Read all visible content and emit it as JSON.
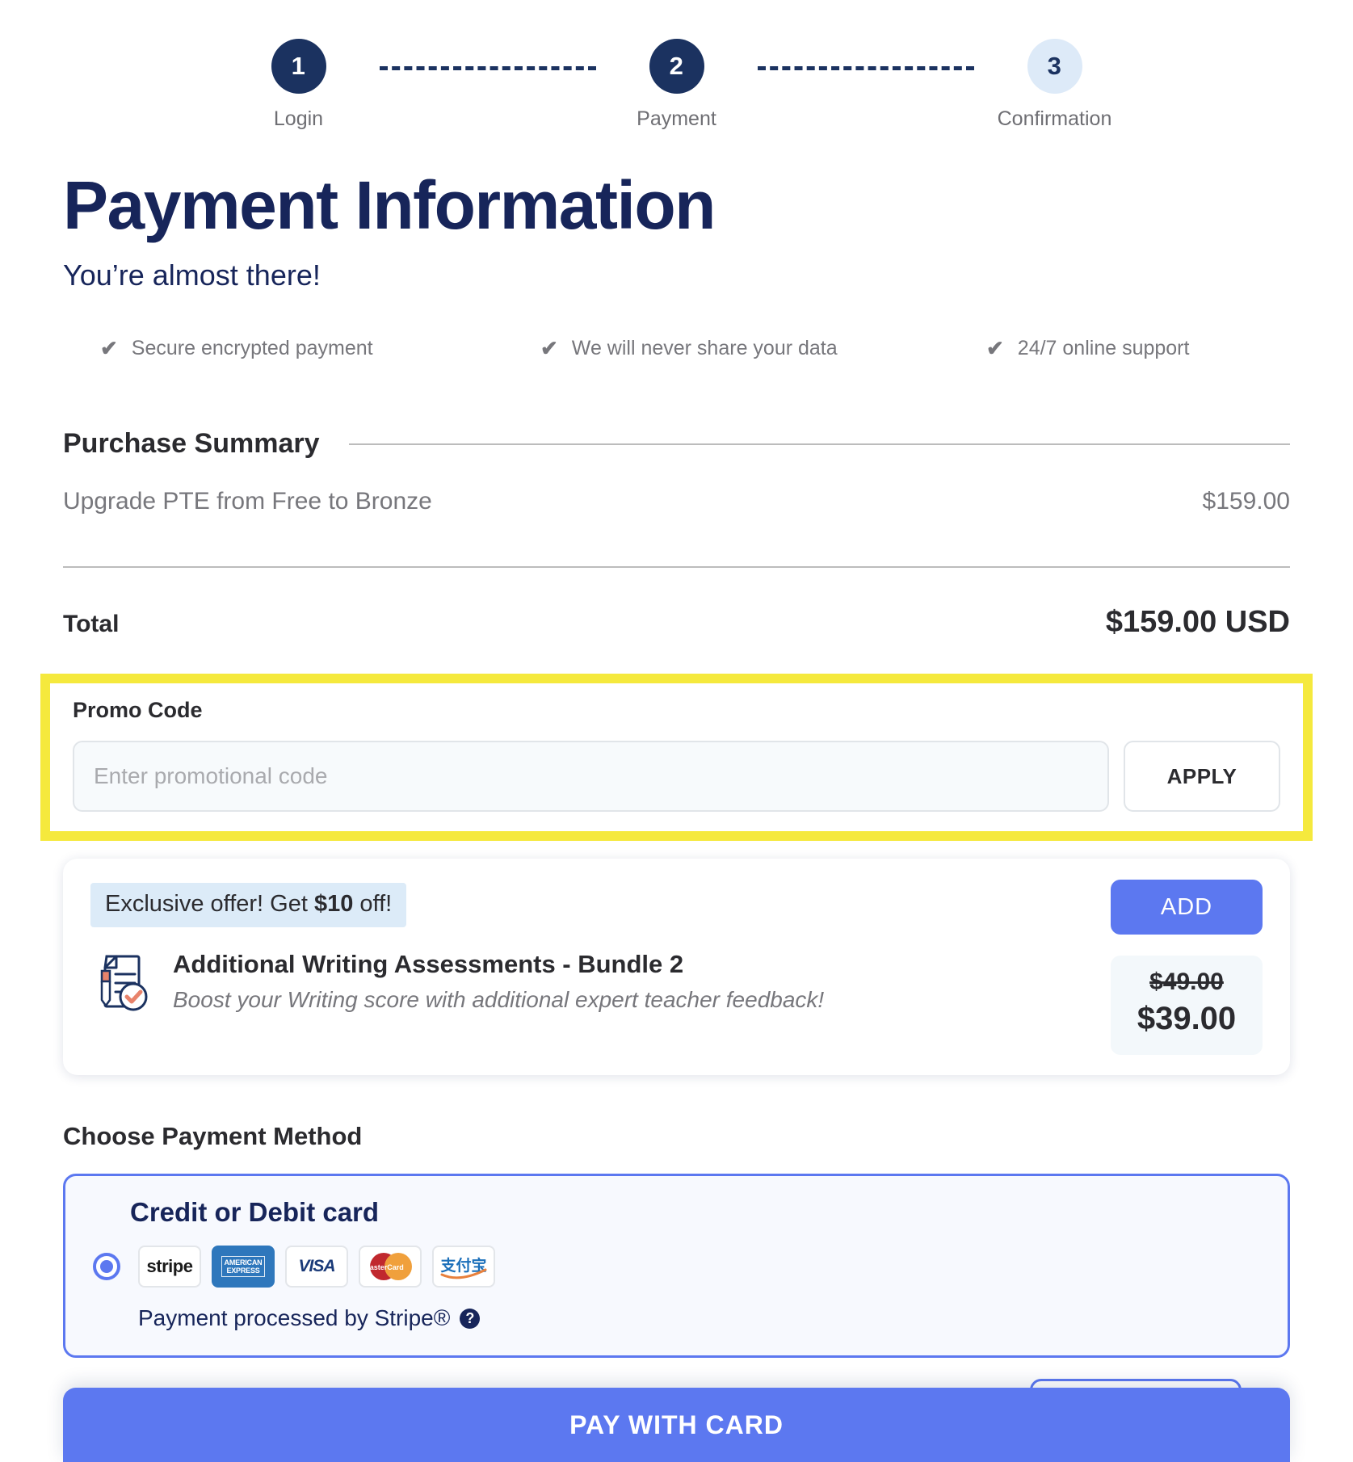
{
  "stepper": {
    "steps": [
      {
        "number": "1",
        "label": "Login",
        "state": "done"
      },
      {
        "number": "2",
        "label": "Payment",
        "state": "active"
      },
      {
        "number": "3",
        "label": "Confirmation",
        "state": "upcoming"
      }
    ]
  },
  "header": {
    "title": "Payment Information",
    "subtitle": "You’re almost there!"
  },
  "trust_badges": [
    {
      "icon": "check-icon",
      "label": "Secure encrypted payment"
    },
    {
      "icon": "check-icon",
      "label": "We will never share your data"
    },
    {
      "icon": "check-icon",
      "label": "24/7 online support"
    }
  ],
  "purchase_summary": {
    "title": "Purchase Summary",
    "line_items": [
      {
        "description": "Upgrade PTE from Free to Bronze",
        "amount": "$159.00"
      }
    ],
    "total_label": "Total",
    "total_amount": "$159.00 USD"
  },
  "promo": {
    "label": "Promo Code",
    "placeholder": "Enter promotional code",
    "value": "",
    "apply_label": "APPLY",
    "highlight_color": "#F5E93D"
  },
  "offer": {
    "badge_prefix": "Exclusive offer! Get ",
    "badge_amount": "$10",
    "badge_suffix": " off!",
    "icon": "document-assessment-icon",
    "name": "Additional Writing Assessments - Bundle 2",
    "description": "Boost your Writing score with additional expert teacher feedback!",
    "add_label": "ADD",
    "price_original": "$49.00",
    "price_discounted": "$39.00",
    "accent_color": "#5C78F0"
  },
  "payment_method": {
    "section_title": "Choose Payment Method",
    "selected": "credit-or-debit-card",
    "option_name": "Credit or Debit card",
    "logos": [
      {
        "name": "stripe-logo",
        "text": "stripe"
      },
      {
        "name": "american-express-logo",
        "text": "AMERICAN EXPRESS"
      },
      {
        "name": "visa-logo",
        "text": "VISA"
      },
      {
        "name": "mastercard-logo",
        "text": "MasterCard"
      },
      {
        "name": "alipay-logo",
        "text": "支付宝"
      }
    ],
    "processor_note": "Payment processed by Stripe®",
    "help_icon": "question-mark-icon"
  },
  "footer": {
    "pay_label": "PAY WITH CARD"
  }
}
